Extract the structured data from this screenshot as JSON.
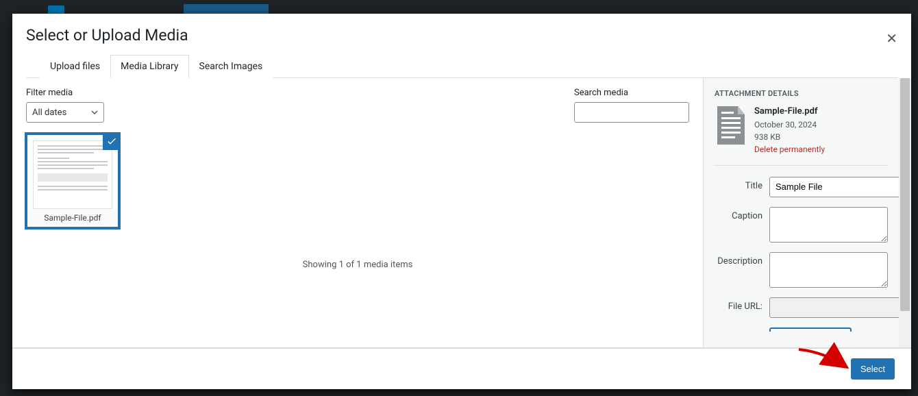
{
  "modal": {
    "title": "Select or Upload Media",
    "tabs": [
      "Upload files",
      "Media Library",
      "Search Images"
    ],
    "active_tab_index": 1
  },
  "filter": {
    "label": "Filter media",
    "date_value": "All dates"
  },
  "search": {
    "label": "Search media",
    "value": ""
  },
  "items": [
    {
      "filename": "Sample-File.pdf",
      "selected": true
    }
  ],
  "status_text": "Showing 1 of 1 media items",
  "details": {
    "heading": "ATTACHMENT DETAILS",
    "filename": "Sample-File.pdf",
    "date": "October 30, 2024",
    "size": "938 KB",
    "delete_label": "Delete permanently",
    "fields": {
      "title_label": "Title",
      "title_value": "Sample File",
      "caption_label": "Caption",
      "caption_value": "",
      "description_label": "Description",
      "description_value": "",
      "fileurl_label": "File URL:",
      "fileurl_value": ""
    }
  },
  "footer": {
    "select_label": "Select"
  }
}
